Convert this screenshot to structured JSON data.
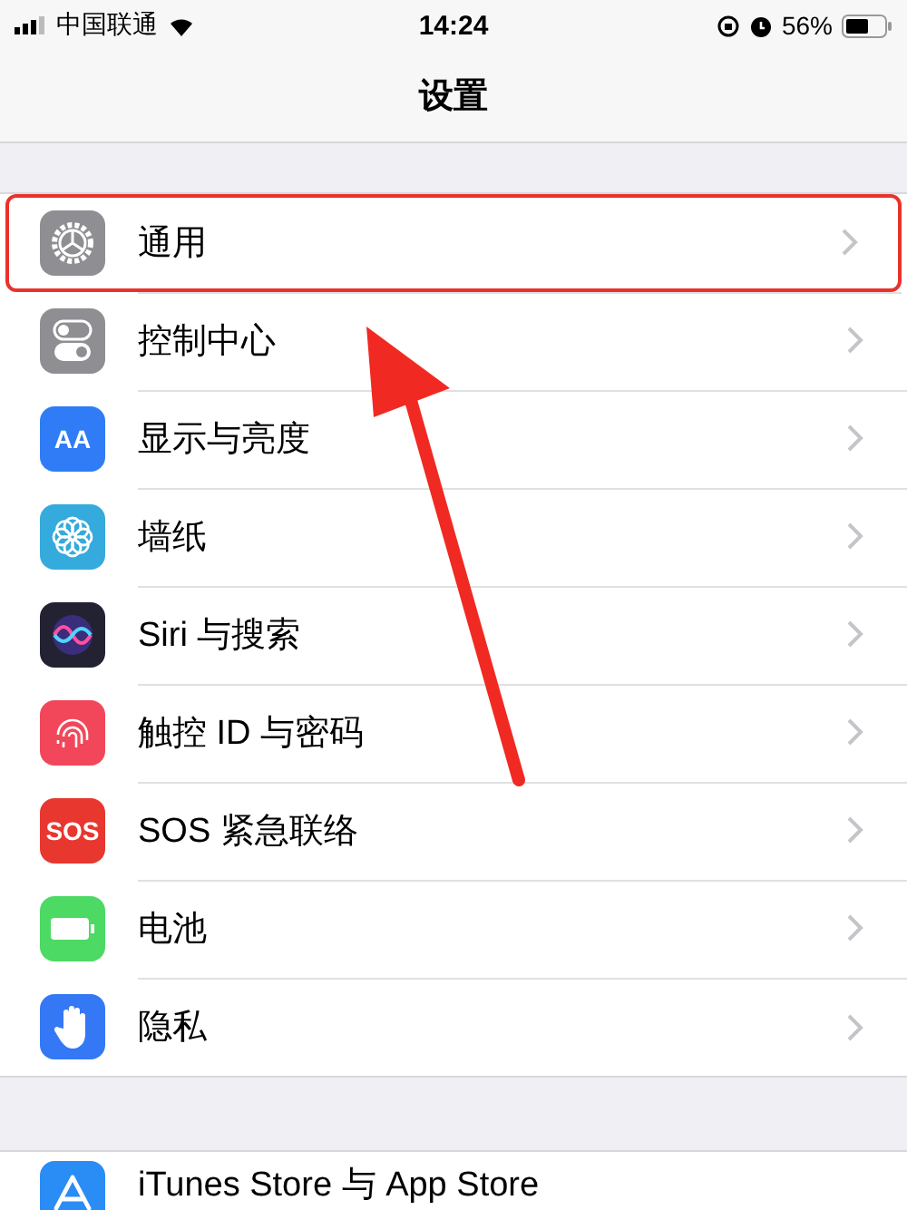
{
  "status_bar": {
    "carrier": "中国联通",
    "time": "14:24",
    "battery": "56%"
  },
  "title": "设置",
  "sections": [
    {
      "rows": [
        {
          "label": "通用",
          "kind": "gear",
          "color": "#8e8e93",
          "highlighted": true
        },
        {
          "label": "控制中心",
          "kind": "toggles",
          "color": "#8e8e93",
          "highlighted": false
        },
        {
          "label": "显示与亮度",
          "kind": "text",
          "icon_text": "AA",
          "color": "#2f7cf6",
          "highlighted": false
        },
        {
          "label": "墙纸",
          "kind": "flower",
          "color": "#35aadc",
          "highlighted": false
        },
        {
          "label": "Siri 与搜索",
          "kind": "siri",
          "color": "#222233",
          "highlighted": false
        },
        {
          "label": "触控 ID 与密码",
          "kind": "fingerprint",
          "color": "#f2475a",
          "highlighted": false
        },
        {
          "label": "SOS 紧急联络",
          "kind": "text",
          "icon_text": "SOS",
          "color": "#e7372f",
          "highlighted": false
        },
        {
          "label": "电池",
          "kind": "battery",
          "color": "#4cd964",
          "highlighted": false
        },
        {
          "label": "隐私",
          "kind": "hand",
          "color": "#3478f6",
          "highlighted": false
        }
      ]
    },
    {
      "rows": [
        {
          "label": "iTunes Store 与 App Store",
          "kind": "appstore",
          "color": "#2a8df5",
          "highlighted": false
        }
      ]
    }
  ]
}
